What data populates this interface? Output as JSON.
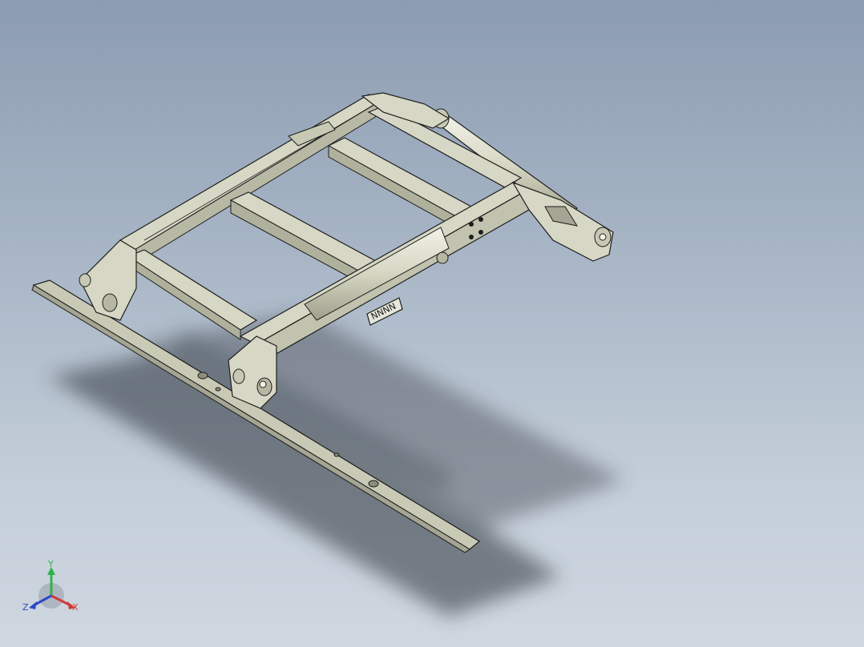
{
  "viewport": {
    "background_top": "#8c9cb1",
    "background_bottom": "#cfd7e0",
    "part_color": "#d6d7c4",
    "part_shade": "#b8b9a4",
    "edge_color": "#1e1e1e",
    "shadow_color": "#3a3f47"
  },
  "triad": {
    "x_label": "X",
    "y_label": "Y",
    "z_label": "Z",
    "x_color": "#d23a3a",
    "y_color": "#2fb24a",
    "z_color": "#2d48c9"
  },
  "model": {
    "plate_marking": "NNNN"
  }
}
